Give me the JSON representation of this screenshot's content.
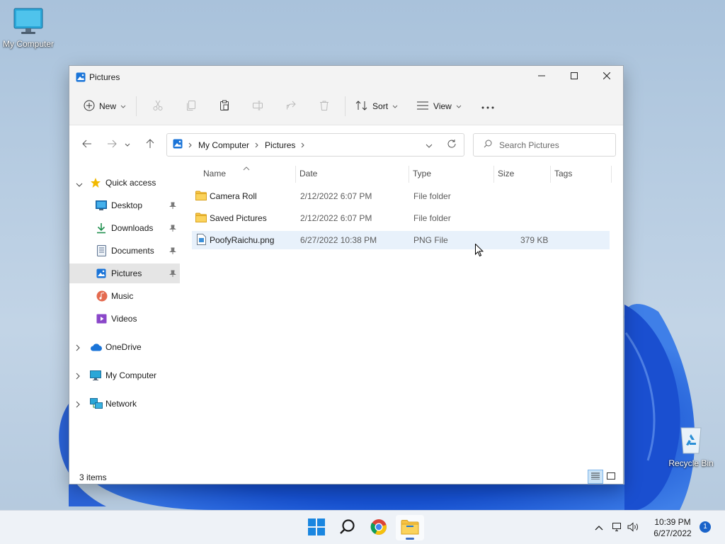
{
  "desktop": {
    "icons": [
      {
        "label": "My Computer",
        "icon": "monitor-icon"
      },
      {
        "label": "Recycle Bin",
        "icon": "recycle-bin-icon"
      }
    ]
  },
  "window": {
    "title": "Pictures",
    "icon": "pictures-icon",
    "buttons": [
      "minimize-icon",
      "maximize-icon",
      "close-icon"
    ]
  },
  "commandbar": {
    "new_label": "New",
    "sort_label": "Sort",
    "view_label": "View",
    "icons": [
      "cut-icon",
      "copy-icon",
      "paste-icon",
      "rename-icon",
      "share-icon",
      "delete-icon",
      "more-icon"
    ]
  },
  "address": {
    "crumbs": [
      "My Computer",
      "Pictures"
    ],
    "search_placeholder": "Search Pictures"
  },
  "navpane": {
    "items": [
      {
        "label": "Quick access",
        "icon": "star-icon"
      },
      {
        "label": "Desktop",
        "icon": "desktop-icon"
      },
      {
        "label": "Downloads",
        "icon": "download-icon"
      },
      {
        "label": "Documents",
        "icon": "documents-icon"
      },
      {
        "label": "Pictures",
        "icon": "pictures-icon"
      },
      {
        "label": "Music",
        "icon": "music-icon"
      },
      {
        "label": "Videos",
        "icon": "videos-icon"
      },
      {
        "label": "OneDrive",
        "icon": "cloud-icon"
      },
      {
        "label": "My Computer",
        "icon": "monitor-icon"
      },
      {
        "label": "Network",
        "icon": "network-icon"
      }
    ]
  },
  "filelist": {
    "columns": [
      "Name",
      "Date",
      "Type",
      "Size",
      "Tags"
    ],
    "rows": [
      {
        "name": "Camera Roll",
        "date": "2/12/2022 6:07 PM",
        "type": "File folder",
        "size": "",
        "icon": "folder-icon"
      },
      {
        "name": "Saved Pictures",
        "date": "2/12/2022 6:07 PM",
        "type": "File folder",
        "size": "",
        "icon": "folder-icon"
      },
      {
        "name": "PoofyRaichu.png",
        "date": "6/27/2022 10:38 PM",
        "type": "PNG File",
        "size": "379 KB",
        "icon": "image-file-icon"
      }
    ]
  },
  "status": {
    "item_count": "3 items"
  },
  "taskbar": {
    "apps": [
      "start-icon",
      "search-icon",
      "chrome-icon",
      "file-explorer-icon"
    ],
    "time": "10:39 PM",
    "date": "6/27/2022",
    "notification_count": "1"
  },
  "colors": {
    "accent": "#0067c0",
    "folder": "#f6c244",
    "selection": "#e5e5e5",
    "hover": "#e8f1fb"
  }
}
